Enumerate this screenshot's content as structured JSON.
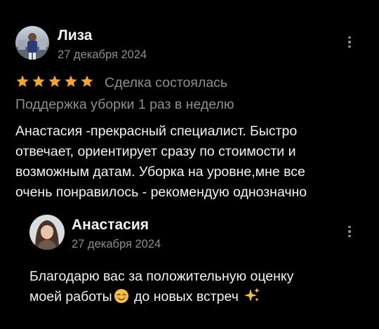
{
  "review": {
    "author": "Лиза",
    "date": "27 декабря 2024",
    "rating": 5,
    "rating_max": 5,
    "deal_status": "Сделка состоялась",
    "service": "Поддержка уборки 1 раз в неделю",
    "text_lines": [
      "Анастасия -прекрасный специалист. Быстро",
      "отвечает, ориентирует сразу по стоимости и",
      "возможным датам. Уборка на уровне,мне все",
      "очень понравилось - рекомендую однозначно"
    ]
  },
  "reply": {
    "author": "Анастасия",
    "date": "27 декабря 2024",
    "line1": "Благодарю вас за положительную оценку",
    "line2_before": "моей работы",
    "line2_after": " до новых встреч ",
    "emoji_1": "smiling-face-icon",
    "emoji_2": "sparkles-icon"
  },
  "colors": {
    "background": "#000000",
    "text": "#f2f2f2",
    "muted": "#8e8e93",
    "star": "#f5a623"
  }
}
